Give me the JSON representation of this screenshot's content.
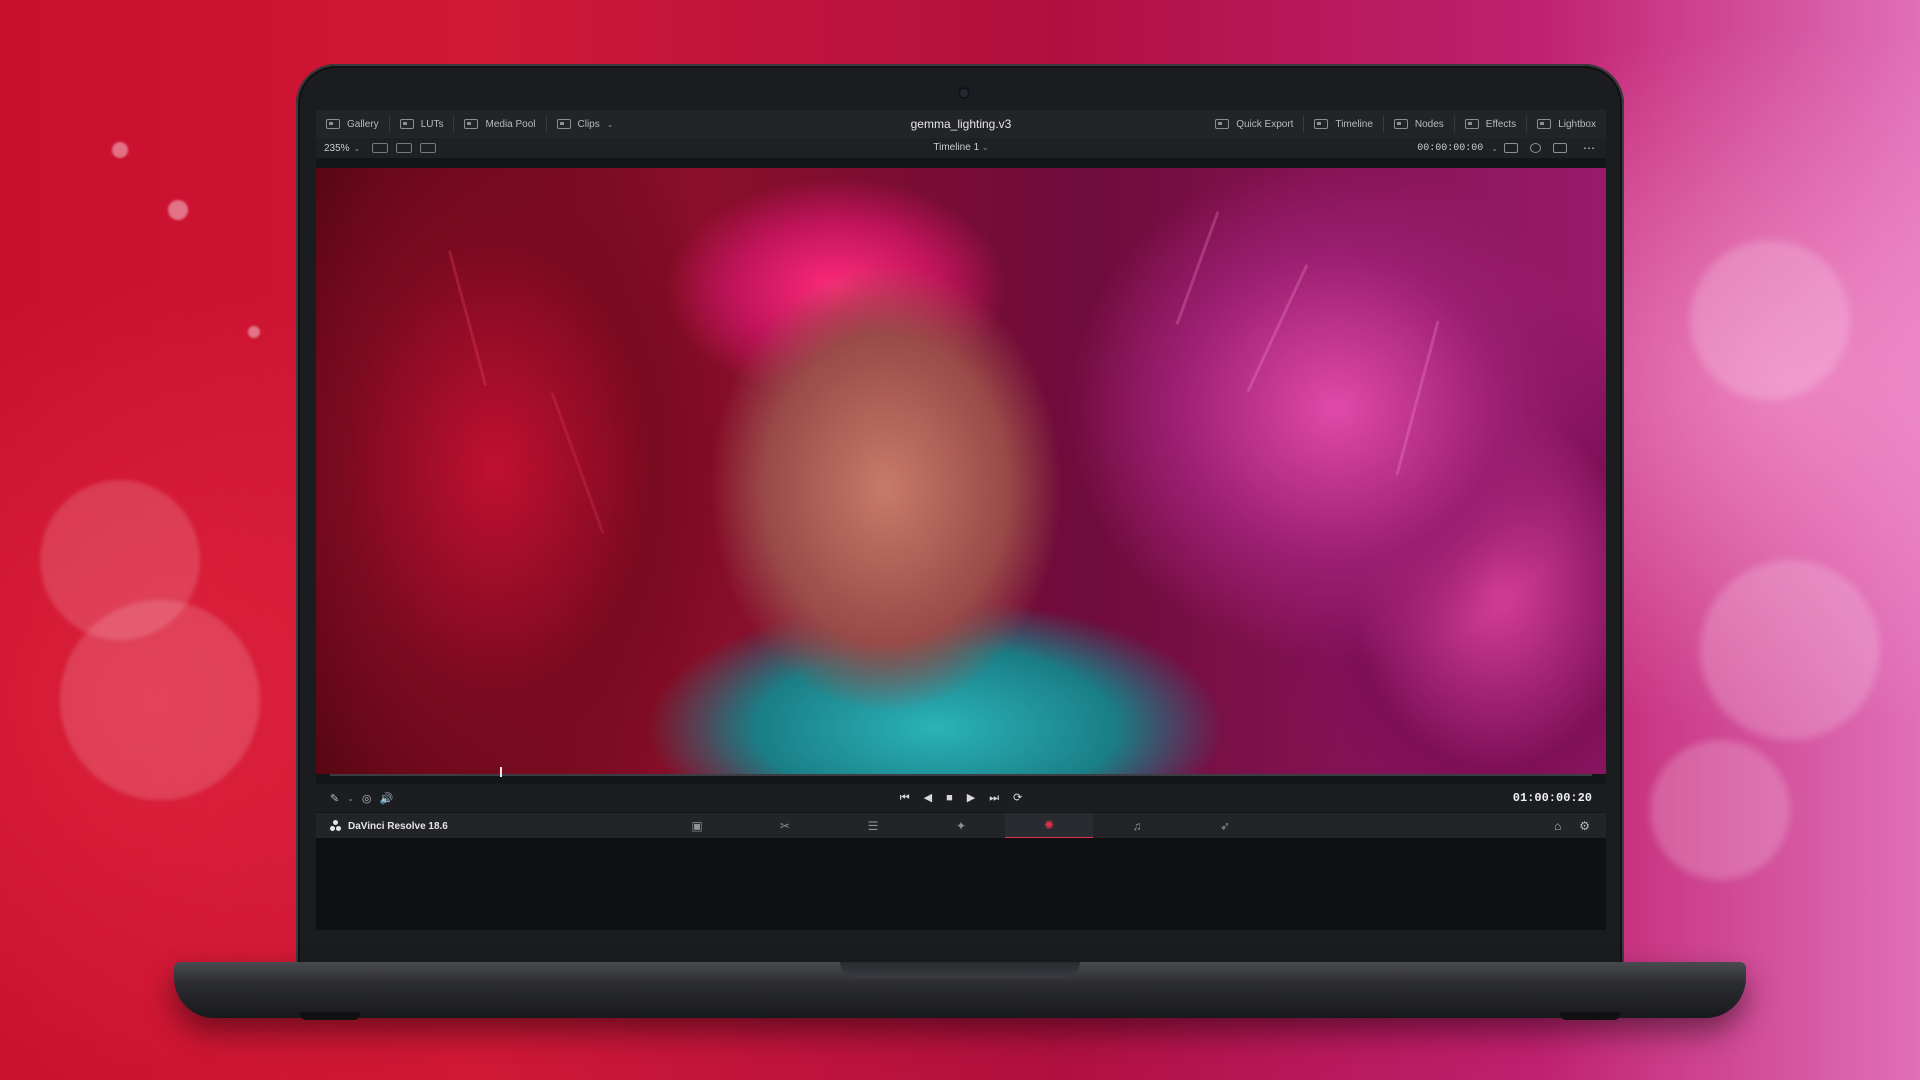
{
  "app": {
    "project_title": "gemma_lighting.v3",
    "brand_name": "DaVinci Resolve 18.6"
  },
  "topbar": {
    "left": [
      {
        "label": "Gallery",
        "icon": "gallery-icon"
      },
      {
        "label": "LUTs",
        "icon": "luts-icon"
      },
      {
        "label": "Media Pool",
        "icon": "media-pool-icon"
      },
      {
        "label": "Clips",
        "icon": "clips-icon"
      }
    ],
    "right": [
      {
        "label": "Quick Export",
        "icon": "export-icon"
      },
      {
        "label": "Timeline",
        "icon": "timeline-icon"
      },
      {
        "label": "Nodes",
        "icon": "nodes-icon"
      },
      {
        "label": "Effects",
        "icon": "fx-icon"
      },
      {
        "label": "Lightbox",
        "icon": "lightbox-icon"
      }
    ]
  },
  "viewer_bar": {
    "zoom": "235%",
    "timeline_name": "Timeline 1",
    "timecode": "00:00:00:00"
  },
  "transport": {
    "current_timecode": "01:00:00:20",
    "buttons": [
      "skip-to-start",
      "play-reverse",
      "stop",
      "play",
      "skip-to-end",
      "loop"
    ],
    "glyphs": {
      "skip_start": "⏮",
      "reverse": "◀",
      "stop": "■",
      "play": "▶",
      "skip_end": "⏭",
      "loop": "⟳",
      "volume": "🔊"
    }
  },
  "pages": {
    "items": [
      {
        "name": "media",
        "glyph": "▣"
      },
      {
        "name": "cut",
        "glyph": "✂"
      },
      {
        "name": "edit",
        "glyph": "☰"
      },
      {
        "name": "fusion",
        "glyph": "✦"
      },
      {
        "name": "color",
        "glyph": "✺"
      },
      {
        "name": "fairlight",
        "glyph": "♫"
      },
      {
        "name": "deliver",
        "glyph": "➶"
      }
    ],
    "active": "color",
    "home_glyph": "⌂",
    "settings_glyph": "⚙"
  },
  "colors": {
    "accent": "#e3324b",
    "ui_bg": "#1c1d20"
  }
}
